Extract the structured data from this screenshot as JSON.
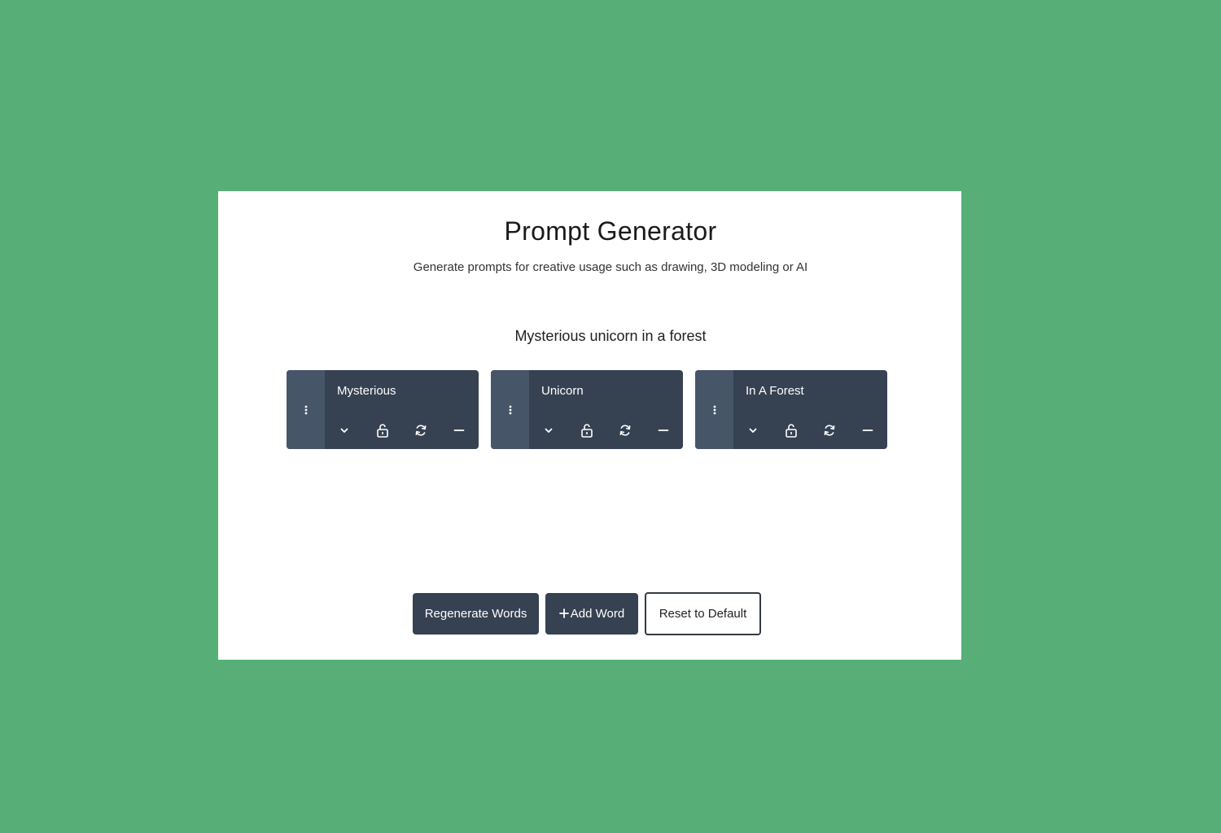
{
  "app": {
    "title": "Prompt Generator",
    "subtitle": "Generate prompts for creative usage such as drawing, 3D modeling or AI",
    "generated_prompt": "Mysterious unicorn in a forest"
  },
  "words": [
    {
      "label": "Mysterious",
      "icons": [
        "drag-handle-icon",
        "chevron-down-icon",
        "unlock-icon",
        "refresh-icon",
        "minus-icon"
      ]
    },
    {
      "label": "Unicorn",
      "icons": [
        "drag-handle-icon",
        "chevron-down-icon",
        "unlock-icon",
        "refresh-icon",
        "minus-icon"
      ]
    },
    {
      "label": "In A Forest",
      "icons": [
        "drag-handle-icon",
        "chevron-down-icon",
        "unlock-icon",
        "refresh-icon",
        "minus-icon"
      ]
    }
  ],
  "actions": {
    "regenerate_label": "Regenerate Words",
    "add_word_label": "Add Word",
    "add_word_icon": "plus-icon",
    "reset_label": "Reset to Default"
  },
  "colors": {
    "background": "#57ae77",
    "panel": "#ffffff",
    "card": "#364152",
    "card_handle": "#475569",
    "button_dark": "#364152"
  }
}
